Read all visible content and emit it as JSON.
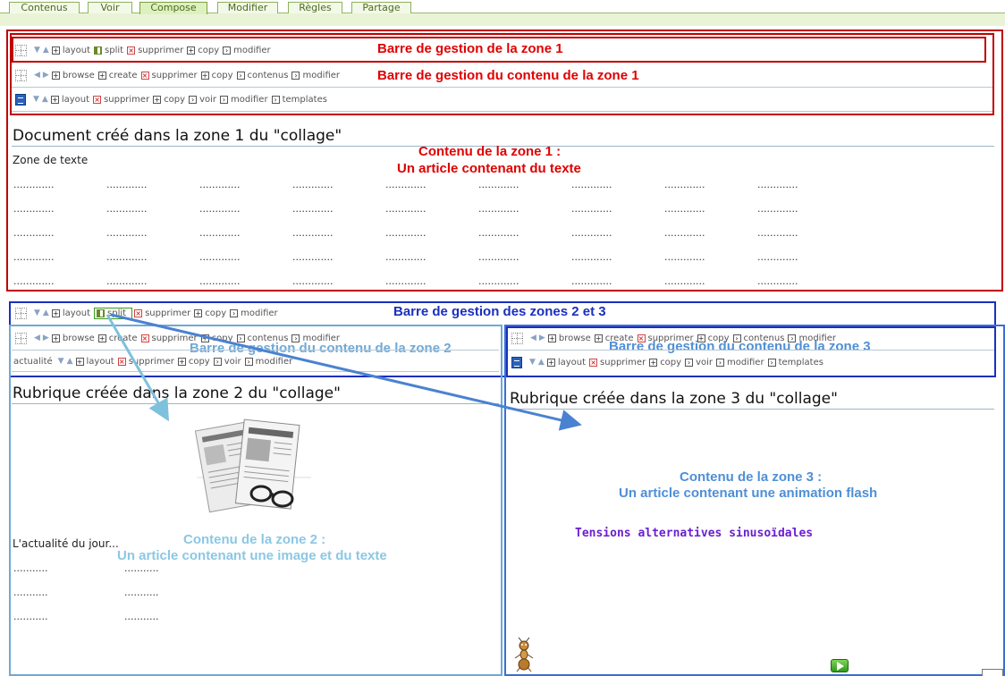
{
  "tabs": [
    "Contenus",
    "Voir",
    "Compose",
    "Modifier",
    "Règles",
    "Partage"
  ],
  "active_tab": "Compose",
  "toolbars": {
    "zone1_manage": [
      "layout",
      "split",
      "supprimer",
      "copy",
      "modifier"
    ],
    "zone1_content": [
      "browse",
      "create",
      "supprimer",
      "copy",
      "contenus",
      "modifier"
    ],
    "zone1_article": [
      "layout",
      "supprimer",
      "copy",
      "voir",
      "modifier",
      "templates"
    ],
    "zone23_manage": [
      "layout",
      "split",
      "supprimer",
      "copy",
      "modifier"
    ],
    "zone2_content": [
      "browse",
      "create",
      "supprimer",
      "copy",
      "contenus",
      "modifier"
    ],
    "zone2_article_prefix": "actualité",
    "zone2_article": [
      "layout",
      "supprimer",
      "copy",
      "voir",
      "modifier"
    ],
    "zone3_content": [
      "browse",
      "create",
      "supprimer",
      "copy",
      "contenus",
      "modifier"
    ],
    "zone3_article": [
      "layout",
      "supprimer",
      "copy",
      "voir",
      "modifier",
      "templates"
    ]
  },
  "annotations": {
    "zone1_bar": "Barre de gestion de la zone 1",
    "zone1_content_bar": "Barre de gestion du contenu de la zone 1",
    "zone1_content_l1": "Contenu de la zone 1 :",
    "zone1_content_l2": "Un article contenant du texte",
    "zone23_bar": "Barre de gestion des zones 2 et 3",
    "zone2_content_bar": "Barre de gestion du contenu de la zone 2",
    "zone3_content_bar": "Barre de gestion du contenu de la zone 3",
    "zone2_content_l1": "Contenu de la zone 2 :",
    "zone2_content_l2": "Un article contenant une image et du texte",
    "zone3_content_l1": "Contenu de la zone 3 :",
    "zone3_content_l2": "Un article contenant une animation flash"
  },
  "zone1": {
    "title": "Document créé dans la zone 1 du \"collage\"",
    "text_label": "Zone de texte",
    "dots": "............."
  },
  "zone2": {
    "title": "Rubrique créée dans la zone 2 du \"collage\"",
    "caption": "L'actualité du jour...",
    "dots": "..........."
  },
  "zone3": {
    "title": "Rubrique créée dans la zone 3 du \"collage\"",
    "flash_text": "Tensions alternatives sinusoïdales"
  },
  "colors": {
    "zone1_border": "#c00000",
    "zone23_border": "#1a2fbf",
    "zone2_border": "#6fa9d6",
    "tab_accent": "#8fb05e"
  },
  "icons": {
    "grid": "grid-layout-icon",
    "doc": "article-icon",
    "newspaper": "newspaper-image",
    "ant": "ant-mascot-icon",
    "play": "play-icon"
  }
}
